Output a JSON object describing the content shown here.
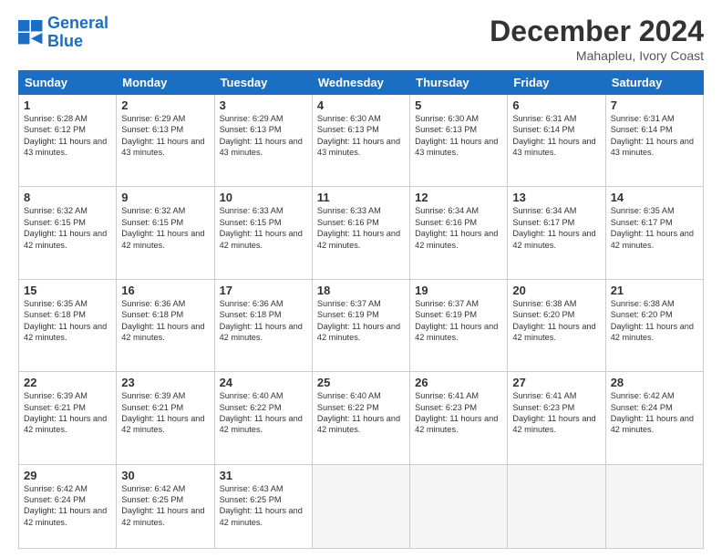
{
  "logo": {
    "line1": "General",
    "line2": "Blue"
  },
  "title": "December 2024",
  "location": "Mahapleu, Ivory Coast",
  "headers": [
    "Sunday",
    "Monday",
    "Tuesday",
    "Wednesday",
    "Thursday",
    "Friday",
    "Saturday"
  ],
  "weeks": [
    [
      {
        "day": "1",
        "sunrise": "6:28 AM",
        "sunset": "6:12 PM",
        "daylight": "11 hours and 43 minutes."
      },
      {
        "day": "2",
        "sunrise": "6:29 AM",
        "sunset": "6:13 PM",
        "daylight": "11 hours and 43 minutes."
      },
      {
        "day": "3",
        "sunrise": "6:29 AM",
        "sunset": "6:13 PM",
        "daylight": "11 hours and 43 minutes."
      },
      {
        "day": "4",
        "sunrise": "6:30 AM",
        "sunset": "6:13 PM",
        "daylight": "11 hours and 43 minutes."
      },
      {
        "day": "5",
        "sunrise": "6:30 AM",
        "sunset": "6:13 PM",
        "daylight": "11 hours and 43 minutes."
      },
      {
        "day": "6",
        "sunrise": "6:31 AM",
        "sunset": "6:14 PM",
        "daylight": "11 hours and 43 minutes."
      },
      {
        "day": "7",
        "sunrise": "6:31 AM",
        "sunset": "6:14 PM",
        "daylight": "11 hours and 43 minutes."
      }
    ],
    [
      {
        "day": "8",
        "sunrise": "6:32 AM",
        "sunset": "6:15 PM",
        "daylight": "11 hours and 42 minutes."
      },
      {
        "day": "9",
        "sunrise": "6:32 AM",
        "sunset": "6:15 PM",
        "daylight": "11 hours and 42 minutes."
      },
      {
        "day": "10",
        "sunrise": "6:33 AM",
        "sunset": "6:15 PM",
        "daylight": "11 hours and 42 minutes."
      },
      {
        "day": "11",
        "sunrise": "6:33 AM",
        "sunset": "6:16 PM",
        "daylight": "11 hours and 42 minutes."
      },
      {
        "day": "12",
        "sunrise": "6:34 AM",
        "sunset": "6:16 PM",
        "daylight": "11 hours and 42 minutes."
      },
      {
        "day": "13",
        "sunrise": "6:34 AM",
        "sunset": "6:17 PM",
        "daylight": "11 hours and 42 minutes."
      },
      {
        "day": "14",
        "sunrise": "6:35 AM",
        "sunset": "6:17 PM",
        "daylight": "11 hours and 42 minutes."
      }
    ],
    [
      {
        "day": "15",
        "sunrise": "6:35 AM",
        "sunset": "6:18 PM",
        "daylight": "11 hours and 42 minutes."
      },
      {
        "day": "16",
        "sunrise": "6:36 AM",
        "sunset": "6:18 PM",
        "daylight": "11 hours and 42 minutes."
      },
      {
        "day": "17",
        "sunrise": "6:36 AM",
        "sunset": "6:18 PM",
        "daylight": "11 hours and 42 minutes."
      },
      {
        "day": "18",
        "sunrise": "6:37 AM",
        "sunset": "6:19 PM",
        "daylight": "11 hours and 42 minutes."
      },
      {
        "day": "19",
        "sunrise": "6:37 AM",
        "sunset": "6:19 PM",
        "daylight": "11 hours and 42 minutes."
      },
      {
        "day": "20",
        "sunrise": "6:38 AM",
        "sunset": "6:20 PM",
        "daylight": "11 hours and 42 minutes."
      },
      {
        "day": "21",
        "sunrise": "6:38 AM",
        "sunset": "6:20 PM",
        "daylight": "11 hours and 42 minutes."
      }
    ],
    [
      {
        "day": "22",
        "sunrise": "6:39 AM",
        "sunset": "6:21 PM",
        "daylight": "11 hours and 42 minutes."
      },
      {
        "day": "23",
        "sunrise": "6:39 AM",
        "sunset": "6:21 PM",
        "daylight": "11 hours and 42 minutes."
      },
      {
        "day": "24",
        "sunrise": "6:40 AM",
        "sunset": "6:22 PM",
        "daylight": "11 hours and 42 minutes."
      },
      {
        "day": "25",
        "sunrise": "6:40 AM",
        "sunset": "6:22 PM",
        "daylight": "11 hours and 42 minutes."
      },
      {
        "day": "26",
        "sunrise": "6:41 AM",
        "sunset": "6:23 PM",
        "daylight": "11 hours and 42 minutes."
      },
      {
        "day": "27",
        "sunrise": "6:41 AM",
        "sunset": "6:23 PM",
        "daylight": "11 hours and 42 minutes."
      },
      {
        "day": "28",
        "sunrise": "6:42 AM",
        "sunset": "6:24 PM",
        "daylight": "11 hours and 42 minutes."
      }
    ],
    [
      {
        "day": "29",
        "sunrise": "6:42 AM",
        "sunset": "6:24 PM",
        "daylight": "11 hours and 42 minutes."
      },
      {
        "day": "30",
        "sunrise": "6:42 AM",
        "sunset": "6:25 PM",
        "daylight": "11 hours and 42 minutes."
      },
      {
        "day": "31",
        "sunrise": "6:43 AM",
        "sunset": "6:25 PM",
        "daylight": "11 hours and 42 minutes."
      },
      null,
      null,
      null,
      null
    ]
  ]
}
